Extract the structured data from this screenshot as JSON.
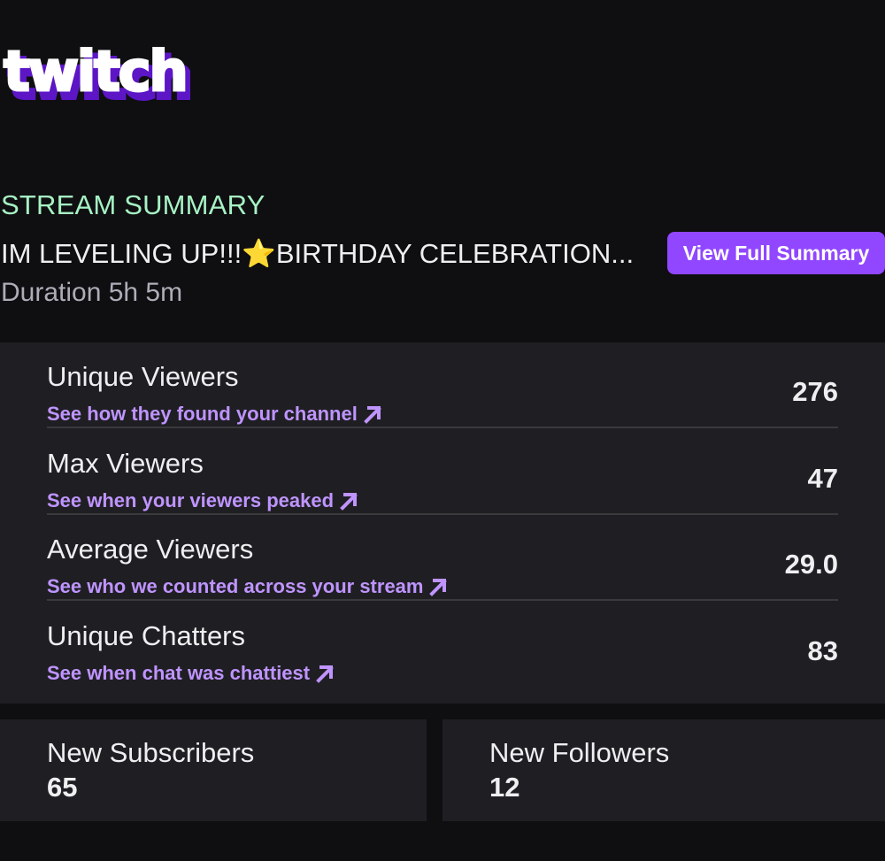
{
  "brand": {
    "logo_text": "twitch",
    "color": "#9147ff"
  },
  "summary": {
    "section_label": "STREAM SUMMARY",
    "title_before": "IM LEVELING UP!!!",
    "title_star": "⭐",
    "title_after": "BIRTHDAY CELEBRATION...",
    "view_button": "View Full Summary",
    "duration": "Duration 5h 5m"
  },
  "stats": [
    {
      "label": "Unique Viewers",
      "link": "See how they found your channel",
      "value": "276"
    },
    {
      "label": "Max Viewers",
      "link": "See when your viewers peaked",
      "value": "47"
    },
    {
      "label": "Average Viewers",
      "link": "See who we counted across your stream",
      "value": "29.0"
    },
    {
      "label": "Unique Chatters",
      "link": "See when chat was chattiest",
      "value": "83"
    }
  ],
  "cards": [
    {
      "label": "New Subscribers",
      "value": "65"
    },
    {
      "label": "New Followers",
      "value": "12"
    }
  ],
  "colors": {
    "background": "#0f0e11",
    "panel": "#1f1f23",
    "accent": "#9147ff",
    "link": "#bf94ff",
    "section_label": "#a6f2c4"
  }
}
